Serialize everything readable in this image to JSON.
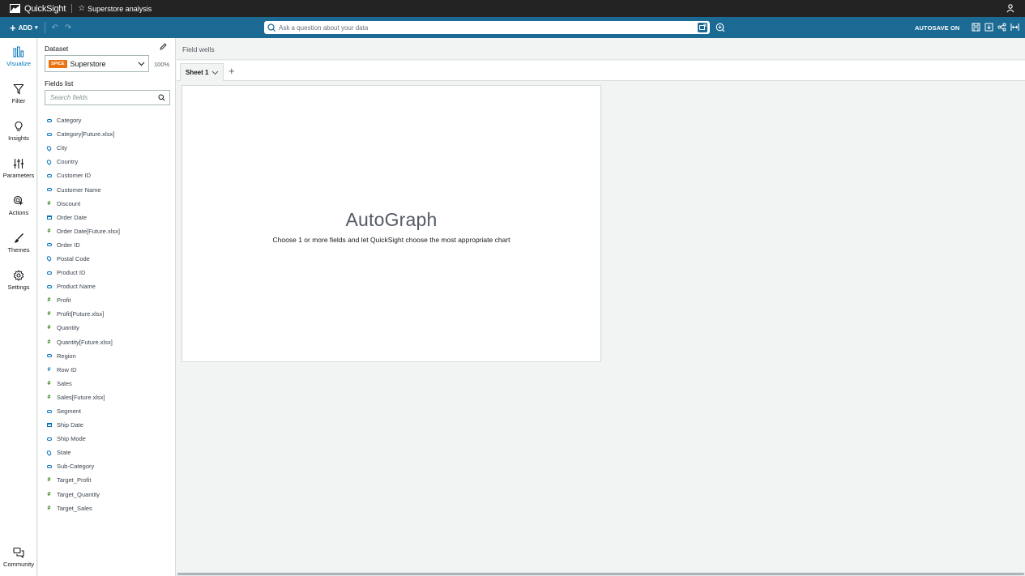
{
  "topbar": {
    "brand": "QuickSight",
    "analysis_name": "Superstore analysis"
  },
  "toolbar": {
    "add_label": "ADD",
    "search_placeholder": "Ask a question about your data",
    "autosave_label": "AUTOSAVE ON"
  },
  "rail": {
    "items": [
      {
        "label": "Visualize",
        "icon": "bar-chart-icon",
        "active": true
      },
      {
        "label": "Filter",
        "icon": "funnel-icon"
      },
      {
        "label": "Insights",
        "icon": "lightbulb-icon"
      },
      {
        "label": "Parameters",
        "icon": "sliders-icon"
      },
      {
        "label": "Actions",
        "icon": "cursor-click-icon"
      },
      {
        "label": "Themes",
        "icon": "brush-icon"
      },
      {
        "label": "Settings",
        "icon": "gear-icon"
      }
    ],
    "community_label": "Community"
  },
  "panel": {
    "dataset_label": "Dataset",
    "dataset_badge": "SPICE",
    "dataset_name": "Superstore",
    "spice_percent": "100%",
    "fields_label": "Fields list",
    "search_placeholder": "Search fields",
    "fields": [
      {
        "name": "Category",
        "type": "dim"
      },
      {
        "name": "Category[Future.xlsx]",
        "type": "dim"
      },
      {
        "name": "City",
        "type": "geo"
      },
      {
        "name": "Country",
        "type": "geo"
      },
      {
        "name": "Customer ID",
        "type": "dim"
      },
      {
        "name": "Customer Name",
        "type": "dim"
      },
      {
        "name": "Discount",
        "type": "measure"
      },
      {
        "name": "Order Date",
        "type": "date"
      },
      {
        "name": "Order Date[Future.xlsx]",
        "type": "measure"
      },
      {
        "name": "Order ID",
        "type": "dim"
      },
      {
        "name": "Postal Code",
        "type": "geo"
      },
      {
        "name": "Product ID",
        "type": "dim"
      },
      {
        "name": "Product Name",
        "type": "dim"
      },
      {
        "name": "Profit",
        "type": "measure"
      },
      {
        "name": "Profit[Future.xlsx]",
        "type": "measure"
      },
      {
        "name": "Quantity",
        "type": "measure"
      },
      {
        "name": "Quantity[Future.xlsx]",
        "type": "measure"
      },
      {
        "name": "Region",
        "type": "dim"
      },
      {
        "name": "Row ID",
        "type": "measure-blue"
      },
      {
        "name": "Sales",
        "type": "measure"
      },
      {
        "name": "Sales[Future.xlsx]",
        "type": "measure"
      },
      {
        "name": "Segment",
        "type": "dim"
      },
      {
        "name": "Ship Date",
        "type": "date"
      },
      {
        "name": "Ship Mode",
        "type": "dim"
      },
      {
        "name": "State",
        "type": "geo"
      },
      {
        "name": "Sub-Category",
        "type": "dim"
      },
      {
        "name": "Target_Profit",
        "type": "measure"
      },
      {
        "name": "Target_Quantity",
        "type": "measure"
      },
      {
        "name": "Target_Sales",
        "type": "measure"
      }
    ]
  },
  "main": {
    "field_wells_label": "Field wells",
    "tab_label": "Sheet 1",
    "visual_title": "AutoGraph",
    "visual_subtitle": "Choose 1 or more fields and let QuickSight choose the most appropriate chart"
  },
  "colors": {
    "topbar_bg": "#232323",
    "toolbar_bg": "#1b6a93",
    "accent_blue": "#0073bb",
    "measure_green": "#1d8102",
    "spice_orange": "#ec7211"
  }
}
